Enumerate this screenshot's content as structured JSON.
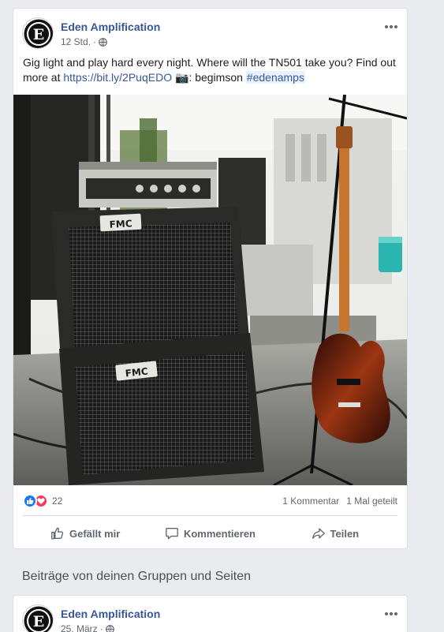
{
  "post": {
    "author": "Eden Amplification",
    "time": "12 Std.",
    "text_main": "Gig light and play hard every night. Where will the TN501 take you? Find out more at ",
    "link": "https://bit.ly/2PuqEDO",
    "camera_emoji": "📷",
    "credit": ": begimson ",
    "hashtag": "#edenamps",
    "photo_label_top": "FMC",
    "photo_label_bottom": "FMC",
    "reaction_count": "22",
    "comments": "1 Kommentar",
    "shares": "1 Mal geteilt",
    "actions": {
      "like": "Gefällt mir",
      "comment": "Kommentieren",
      "share": "Teilen"
    }
  },
  "section_title": "Beiträge von deinen Gruppen und Seiten",
  "second_post": {
    "author": "Eden Amplification",
    "time": "25. März"
  },
  "colors": {
    "link": "#385898",
    "like_blue": "#1877f2",
    "love_red": "#f33e58",
    "background": "#e9ebee"
  },
  "icons": [
    "globe-icon",
    "more-icon",
    "like-reaction-icon",
    "love-reaction-icon",
    "thumbs-up-icon",
    "comment-icon",
    "share-icon"
  ]
}
